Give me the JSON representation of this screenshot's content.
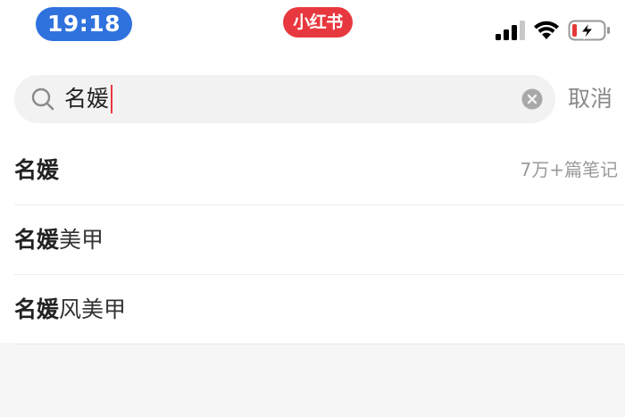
{
  "status_bar": {
    "time": "19:18",
    "app_badge": "小红书",
    "icons": [
      "signal-icon",
      "wifi-icon",
      "battery-charging-icon"
    ]
  },
  "search": {
    "query": "名媛",
    "cancel_label": "取消",
    "icons": [
      "search-icon",
      "clear-icon"
    ]
  },
  "suggestions": [
    {
      "highlight": "名媛",
      "rest": "",
      "count": "7万+篇笔记"
    },
    {
      "highlight": "名媛",
      "rest": "美甲",
      "count": ""
    },
    {
      "highlight": "名媛",
      "rest": "风美甲",
      "count": ""
    }
  ],
  "colors": {
    "time_pill": "#2f72de",
    "app_badge": "#e8383f",
    "caret": "#e8383f",
    "search_bg": "#f2f2f2",
    "page_bg": "#f6f6f6"
  }
}
